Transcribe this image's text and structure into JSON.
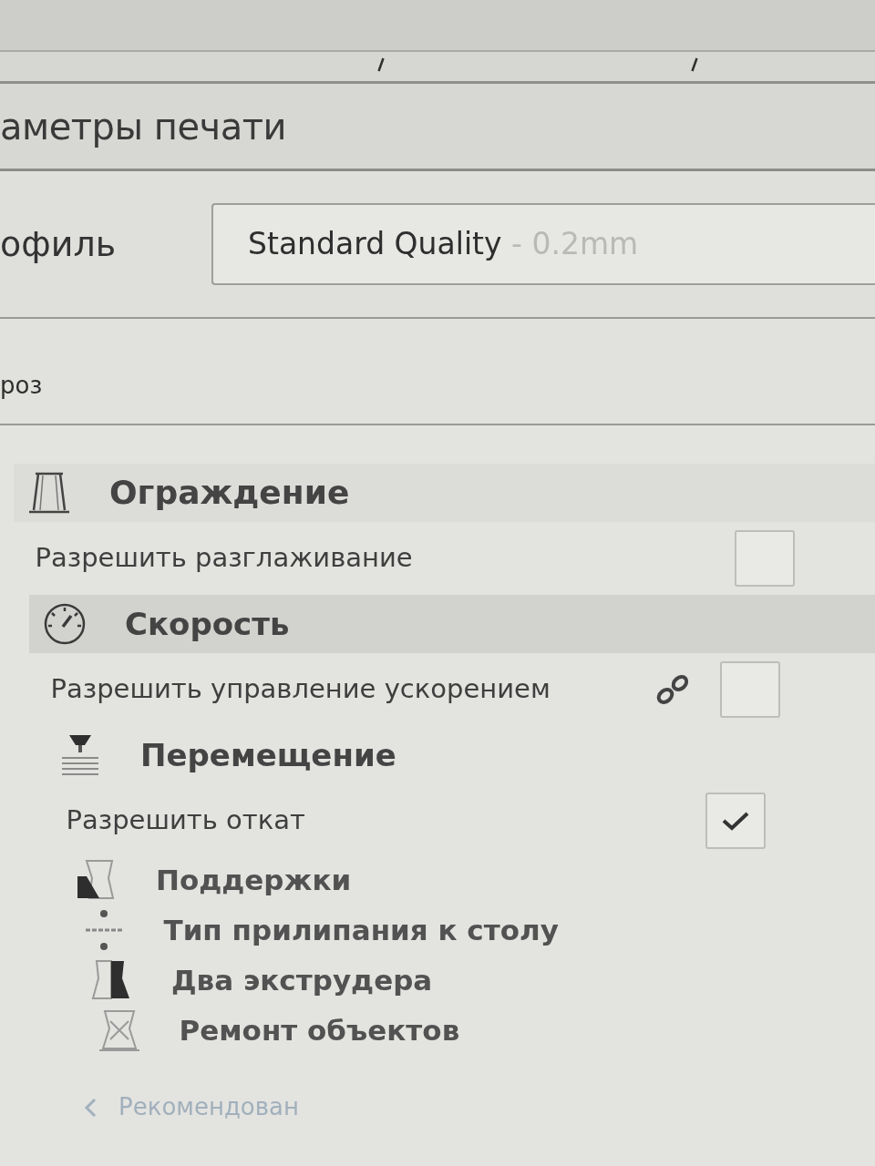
{
  "title": "аметры печати",
  "profile": {
    "label": "офиль",
    "value": "Standard Quality",
    "detail": " - 0.2mm"
  },
  "search": {
    "value": "роз"
  },
  "categories": [
    {
      "kind": "walls",
      "label": "Ограждение",
      "selected": false,
      "children": [
        {
          "label": "Разрешить разглаживание",
          "checked": false,
          "linked": false
        }
      ]
    },
    {
      "kind": "speed",
      "label": "Скорость",
      "selected": true,
      "children": [
        {
          "label": "Разрешить управление ускорением",
          "checked": false,
          "linked": true
        }
      ]
    },
    {
      "kind": "travel",
      "label": "Перемещение",
      "selected": false,
      "children": [
        {
          "label": "Разрешить откат",
          "checked": true,
          "linked": false
        }
      ]
    },
    {
      "kind": "support",
      "label": "Поддержки",
      "selected": false
    },
    {
      "kind": "adhesion",
      "label": "Тип прилипания к столу",
      "selected": false
    },
    {
      "kind": "dual",
      "label": "Два экструдера",
      "selected": false
    },
    {
      "kind": "fixes",
      "label": "Ремонт объектов",
      "selected": false
    }
  ],
  "back_link": "Рекомендован"
}
